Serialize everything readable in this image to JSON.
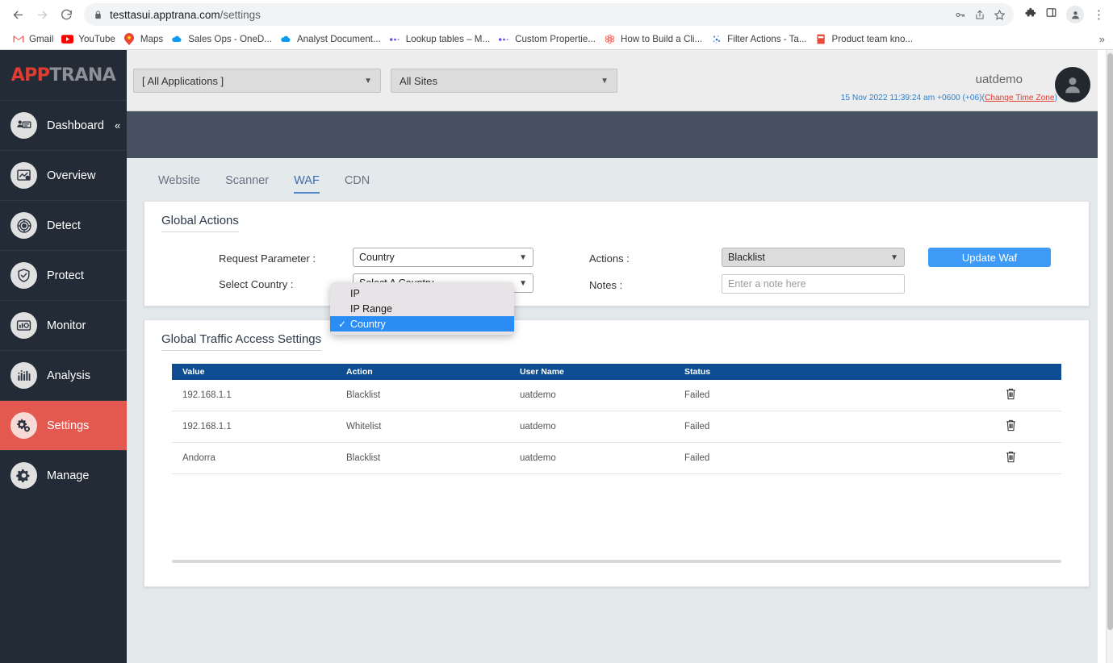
{
  "browser": {
    "nav": {
      "back": "back-arrow",
      "forward": "forward-arrow",
      "reload": "reload"
    },
    "url_host": "testtasui.apptrana.com",
    "url_path": "/settings",
    "lock_icon": "lock-icon",
    "omni_actions": [
      "password-key-icon",
      "share-icon",
      "bookmark-star-icon"
    ],
    "ext_actions": [
      "extensions-puzzle-icon",
      "side-panel-icon",
      "profile-avatar-icon",
      "kebab-menu-icon"
    ],
    "bookmarks": [
      {
        "label": "Gmail",
        "icon": "gmail-icon"
      },
      {
        "label": "YouTube",
        "icon": "youtube-icon"
      },
      {
        "label": "Maps",
        "icon": "maps-pin-icon"
      },
      {
        "label": "Sales Ops - OneD...",
        "icon": "onedrive-cloud-icon"
      },
      {
        "label": "Analyst Document...",
        "icon": "onedrive-cloud-icon"
      },
      {
        "label": "Lookup tables – M...",
        "icon": "dots-icon"
      },
      {
        "label": "Custom Propertie...",
        "icon": "dots-icon"
      },
      {
        "label": "How to Build a Cli...",
        "icon": "flower-icon"
      },
      {
        "label": "Filter Actions - Ta...",
        "icon": "scatter-icon"
      },
      {
        "label": "Product team kno...",
        "icon": "notebook-icon"
      }
    ],
    "bookmark_overflow": "»"
  },
  "sidebar": {
    "brand_part1": "APP",
    "brand_part2": "TRANA",
    "items": [
      {
        "label": "Dashboard",
        "icon": "dashboard-icon",
        "active": false,
        "collapse": "«"
      },
      {
        "label": "Overview",
        "icon": "overview-icon",
        "active": false
      },
      {
        "label": "Detect",
        "icon": "detect-target-icon",
        "active": false
      },
      {
        "label": "Protect",
        "icon": "protect-shield-icon",
        "active": false
      },
      {
        "label": "Monitor",
        "icon": "monitor-icon",
        "active": false
      },
      {
        "label": "Analysis",
        "icon": "analysis-bars-icon",
        "active": false
      },
      {
        "label": "Settings",
        "icon": "settings-gears-icon",
        "active": true
      },
      {
        "label": "Manage",
        "icon": "manage-gear-icon",
        "active": false
      }
    ]
  },
  "topbar": {
    "application_select": "[ All Applications ]",
    "sites_select": "All Sites",
    "user_name": "uatdemo",
    "timestamp": "15 Nov 2022 11:39:24 am +0600 (+06)(",
    "change_time_zone": "Change Time Zone",
    "timestamp_suffix": ")",
    "avatar_icon": "user-avatar-icon"
  },
  "tabs": [
    {
      "label": "Website",
      "active": false
    },
    {
      "label": "Scanner",
      "active": false
    },
    {
      "label": "WAF",
      "active": true
    },
    {
      "label": "CDN",
      "active": false
    }
  ],
  "global_actions": {
    "title": "Global Actions",
    "request_parameter_label": "Request Parameter :",
    "request_parameter_value": "Country",
    "select_country_label": "Select Country :",
    "select_country_value": "Select A Country",
    "actions_label": "Actions :",
    "actions_value": "Blacklist",
    "notes_label": "Notes :",
    "notes_placeholder": "Enter a note here",
    "update_button": "Update Waf",
    "dropdown_open": true,
    "dropdown_options": [
      {
        "label": "IP",
        "selected": false
      },
      {
        "label": "IP Range",
        "selected": false
      },
      {
        "label": "Country",
        "selected": true
      }
    ],
    "check_glyph": "✓"
  },
  "global_traffic": {
    "title": "Global Traffic Access Settings",
    "columns": [
      "Value",
      "Action",
      "User Name",
      "Status",
      ""
    ],
    "rows": [
      {
        "value": "192.168.1.1",
        "action": "Blacklist",
        "user_name": "uatdemo",
        "status": "Failed",
        "delete_icon": "trash-icon"
      },
      {
        "value": "192.168.1.1",
        "action": "Whitelist",
        "user_name": "uatdemo",
        "status": "Failed",
        "delete_icon": "trash-icon"
      },
      {
        "value": "Andorra",
        "action": "Blacklist",
        "user_name": "uatdemo",
        "status": "Failed",
        "delete_icon": "trash-icon"
      }
    ]
  },
  "colors": {
    "sidebar_bg": "#222b36",
    "sidebar_active": "#e4594f",
    "brand_red": "#e03c31",
    "dark_band": "#475060",
    "page_bg": "#e4e9ec",
    "table_header": "#0e4d92",
    "primary_button": "#3d9bf7",
    "dropdown_selected": "#2a8cf5",
    "tab_active": "#4e86c6"
  }
}
